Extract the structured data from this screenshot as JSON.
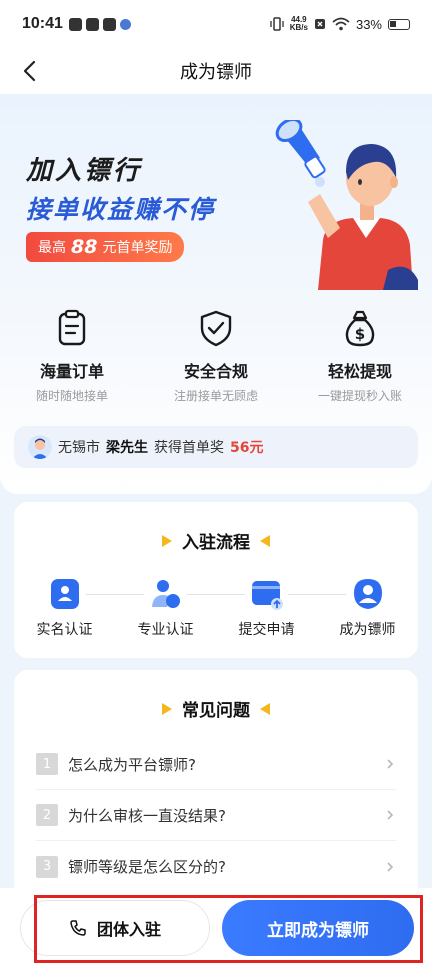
{
  "status_bar": {
    "time": "10:41",
    "net_speed_value": "44.9",
    "net_speed_unit": "KB/s",
    "battery": "33%"
  },
  "header": {
    "title": "成为镖师"
  },
  "hero": {
    "title": "加入镖行",
    "subtitle": "接单收益赚不停",
    "reward_prefix": "最高",
    "reward_amount": "88",
    "reward_suffix": "元首单奖励"
  },
  "features": [
    {
      "title": "海量订单",
      "desc": "随时随地接单",
      "icon": "clipboard-icon"
    },
    {
      "title": "安全合规",
      "desc": "注册接单无顾虑",
      "icon": "shield-check-icon"
    },
    {
      "title": "轻松提现",
      "desc": "一键提现秒入账",
      "icon": "money-bag-icon"
    }
  ],
  "winner": {
    "city": "无锡市",
    "name": "梁先生",
    "text": "获得首单奖",
    "amount": "56元"
  },
  "process": {
    "title": "入驻流程",
    "steps": [
      {
        "label": "实名认证",
        "icon": "id-card-icon"
      },
      {
        "label": "专业认证",
        "icon": "users-icon"
      },
      {
        "label": "提交申请",
        "icon": "upload-folder-icon"
      },
      {
        "label": "成为镖师",
        "icon": "user-badge-icon"
      }
    ]
  },
  "faq": {
    "title": "常见问题",
    "items": [
      {
        "num": "1",
        "text": "怎么成为平台镖师?"
      },
      {
        "num": "2",
        "text": "为什么审核一直没结果?"
      },
      {
        "num": "3",
        "text": "镖师等级是怎么区分的?"
      }
    ]
  },
  "bottom": {
    "group_label": "团体入驻",
    "primary_label": "立即成为镖师"
  },
  "colors": {
    "brand_blue": "#2e6cf0",
    "accent_red": "#e5463b",
    "accent_yellow": "#f5b81c"
  }
}
